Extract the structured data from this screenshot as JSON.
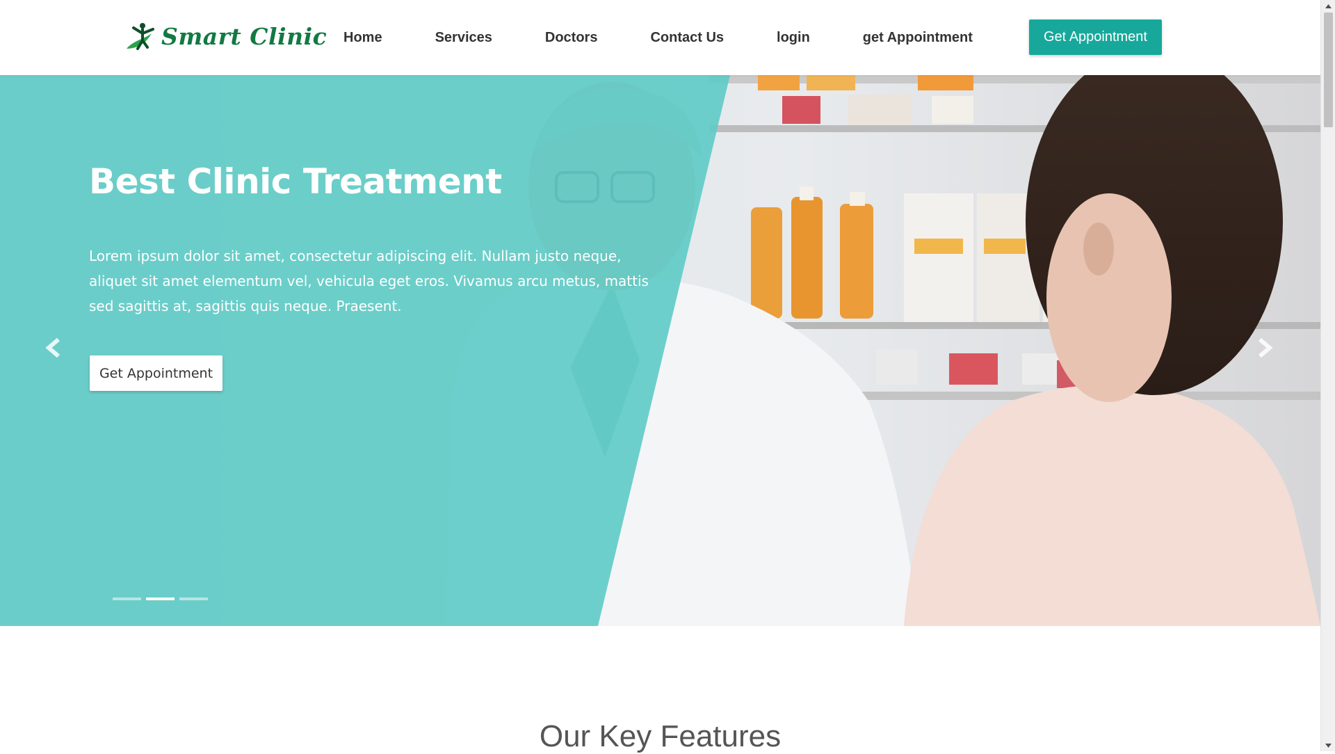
{
  "brand": {
    "name": "Smart Clinic",
    "logo_icon": "leaf-person-icon",
    "color": "#117a43"
  },
  "nav": {
    "links": [
      {
        "label": "Home"
      },
      {
        "label": "Services"
      },
      {
        "label": "Doctors"
      },
      {
        "label": "Contact Us"
      },
      {
        "label": "login"
      },
      {
        "label": "get Appointment"
      }
    ],
    "cta_label": "Get Appointment"
  },
  "hero": {
    "title": "Best Clinic Treatment",
    "description": "Lorem ipsum dolor sit amet, consectetur adipiscing elit. Nullam justo neque, aliquet sit amet elementum vel, vehicula eget eros. Vivamus arcu metus, mattis sed sagittis at, sagittis quis neque. Praesent.",
    "button_label": "Get Appointment",
    "prev_icon": "chevron-left-icon",
    "next_icon": "chevron-right-icon",
    "slide_count": 3,
    "active_slide": 2,
    "overlay_color": "#5ecbc5"
  },
  "features": {
    "title": "Our Key Features"
  },
  "colors": {
    "accent": "#17a89b",
    "text_dark": "#333333",
    "heading_gray": "#555555"
  }
}
